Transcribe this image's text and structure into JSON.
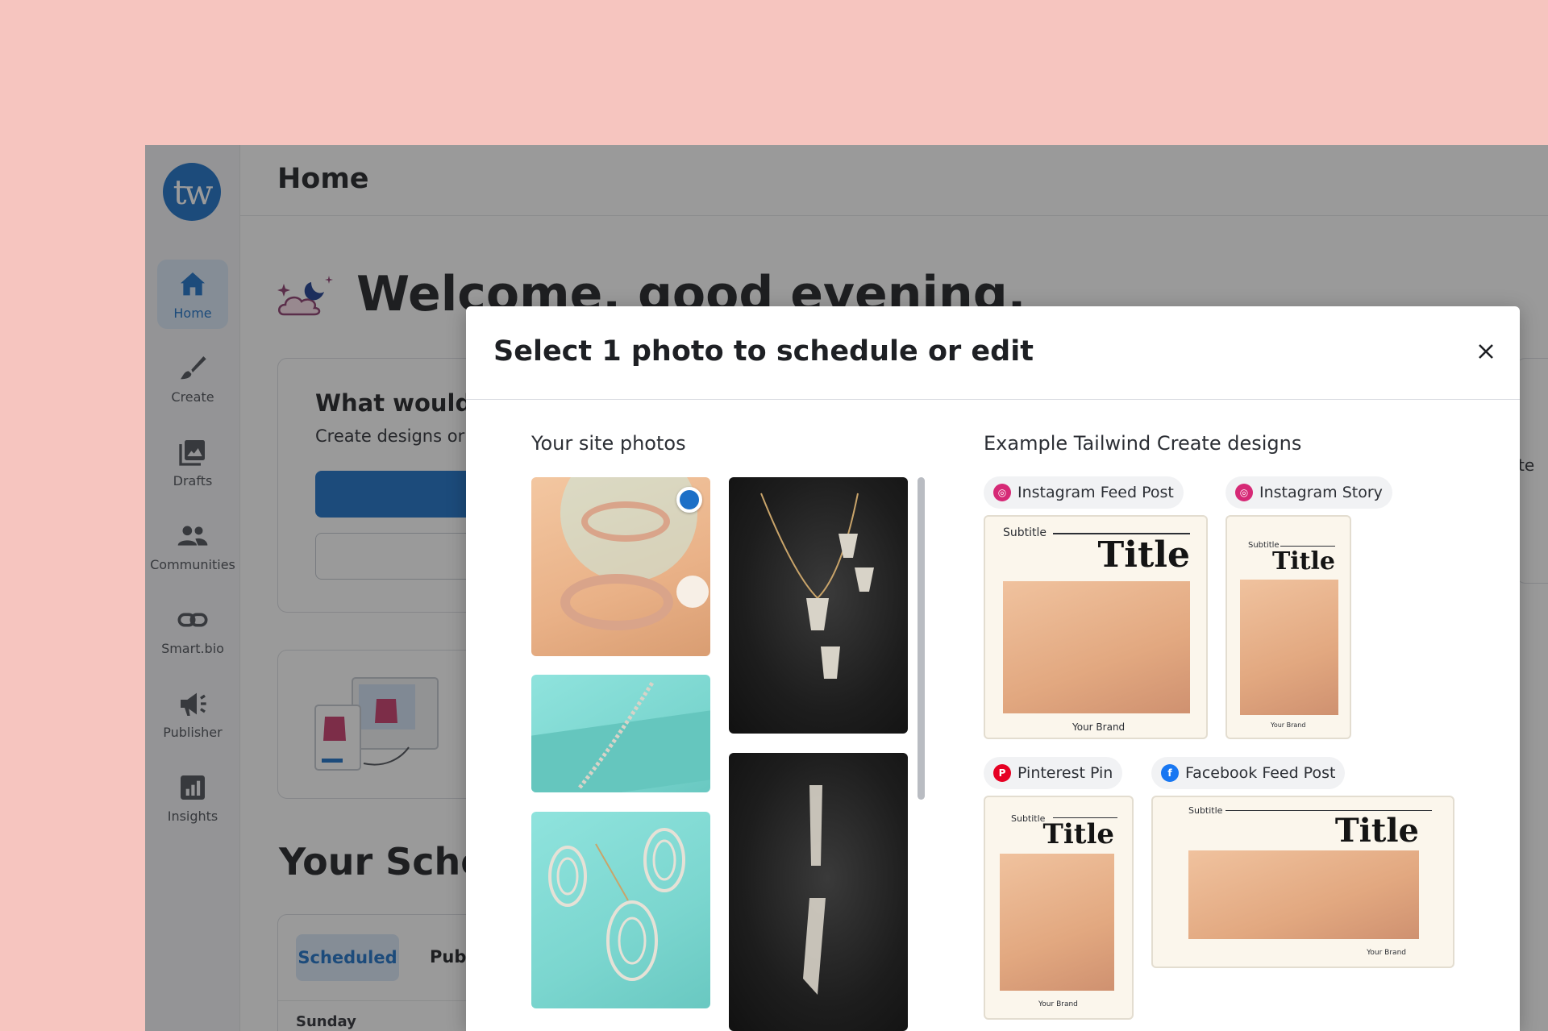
{
  "app": {
    "logo_text": "tw",
    "page_title": "Home",
    "welcome": "Welcome, good evening.",
    "accent": "#1b6fc7",
    "background": "#f6c5bf"
  },
  "sidebar": {
    "items": [
      {
        "label": "Home",
        "icon": "home-icon",
        "active": true
      },
      {
        "label": "Create",
        "icon": "brush-icon",
        "active": false
      },
      {
        "label": "Drafts",
        "icon": "drafts-icon",
        "active": false
      },
      {
        "label": "Communities",
        "icon": "users-icon",
        "active": false
      },
      {
        "label": "Smart.bio",
        "icon": "link-icon",
        "active": false
      },
      {
        "label": "Publisher",
        "icon": "megaphone-icon",
        "active": false
      },
      {
        "label": "Insights",
        "icon": "chart-icon",
        "active": false
      }
    ]
  },
  "main": {
    "card_title": "What would y",
    "card_subtitle": "Create designs or u",
    "schedule_title": "Your Sche",
    "tab_scheduled": "Scheduled",
    "tab_published": "Publ",
    "day_label": "Sunday",
    "right_stub": "te"
  },
  "modal": {
    "title": "Select 1 photo to schedule or edit",
    "site_photos_label": "Your site photos",
    "designs_label": "Example Tailwind Create designs",
    "designs": [
      {
        "platform": "Instagram Feed Post",
        "icon": "instagram-icon",
        "subtitle": "Subtitle",
        "title": "Title",
        "brand": "Your Brand"
      },
      {
        "platform": "Instagram Story",
        "icon": "instagram-icon",
        "subtitle": "Subtitle",
        "title": "Title",
        "brand": "Your Brand"
      },
      {
        "platform": "Pinterest Pin",
        "icon": "pinterest-icon",
        "subtitle": "Subtitle",
        "title": "Title",
        "brand": "Your Brand"
      },
      {
        "platform": "Facebook Feed Post",
        "icon": "facebook-icon",
        "subtitle": "Subtitle",
        "title": "Title",
        "brand": "Your Brand"
      }
    ]
  }
}
